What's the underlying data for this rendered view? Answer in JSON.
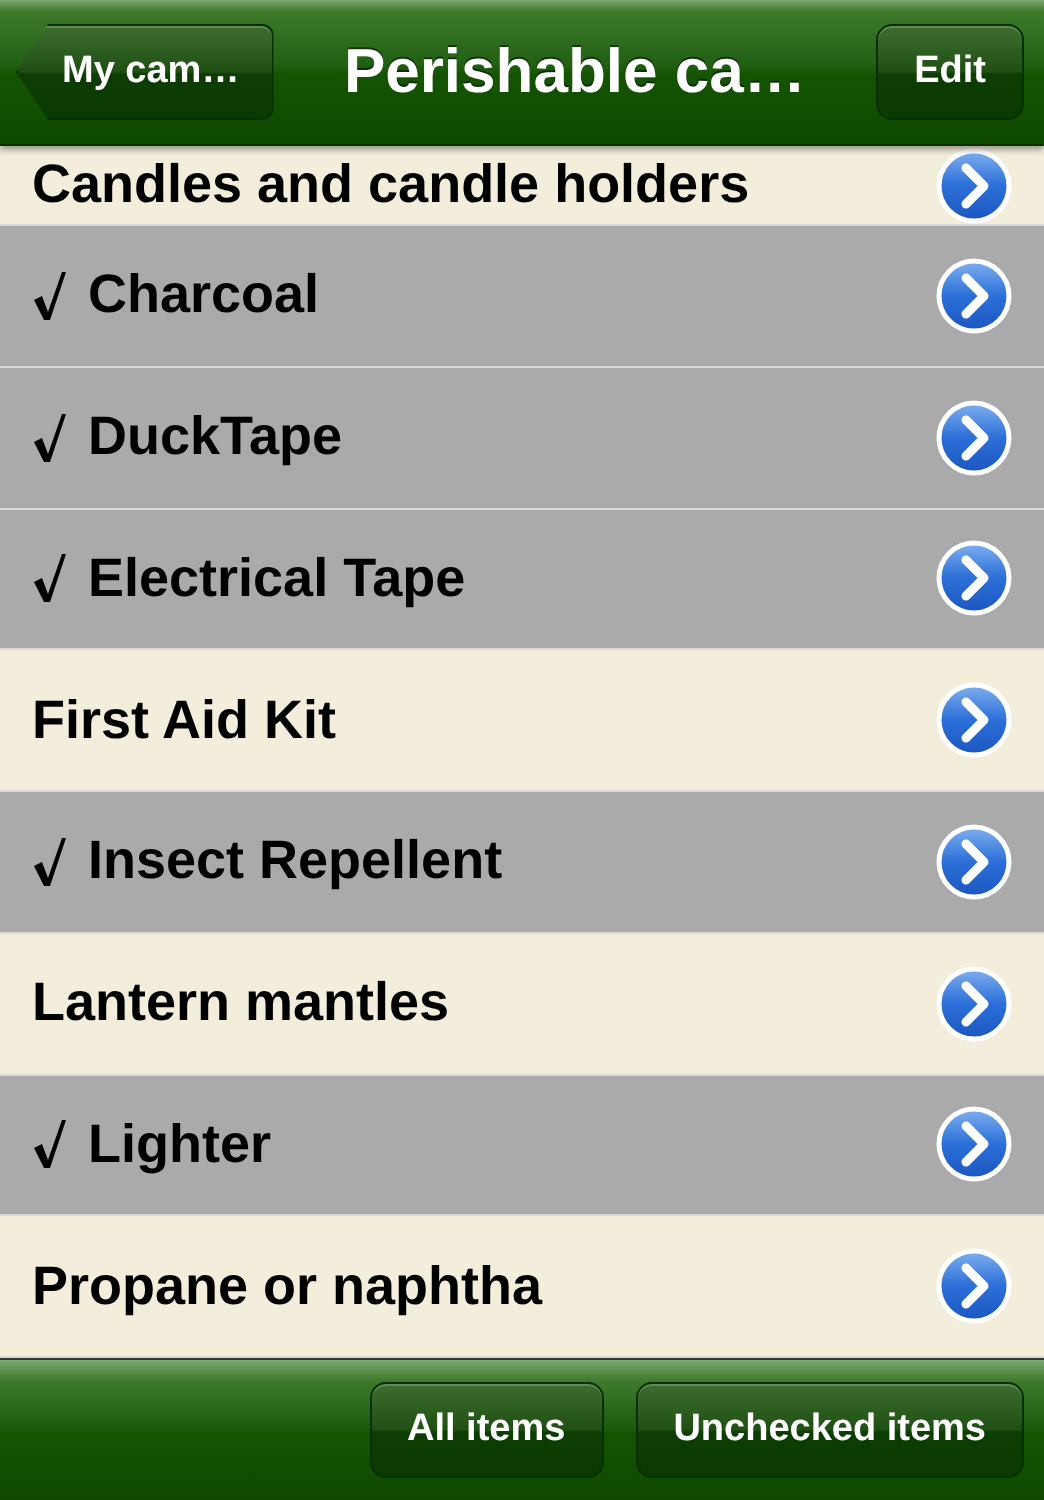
{
  "nav_bar": {
    "back_button": "My cam…",
    "title": "Perishable ca…",
    "edit_button": "Edit"
  },
  "items": [
    {
      "label": "Candles and candle holders",
      "checked": false
    },
    {
      "label": "Charcoal",
      "checked": true
    },
    {
      "label": "DuckTape",
      "checked": true
    },
    {
      "label": "Electrical Tape",
      "checked": true
    },
    {
      "label": "First Aid Kit",
      "checked": false
    },
    {
      "label": "Insect Repellent",
      "checked": true
    },
    {
      "label": "Lantern mantles",
      "checked": false
    },
    {
      "label": "Lighter",
      "checked": true
    },
    {
      "label": "Propane or naphtha",
      "checked": false
    }
  ],
  "toolbar": {
    "buttons": [
      {
        "label": "All items",
        "selected": false
      },
      {
        "label": "Unchecked items",
        "selected": false
      }
    ]
  }
}
